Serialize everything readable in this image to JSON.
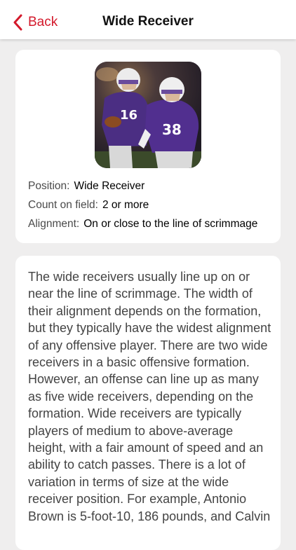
{
  "nav": {
    "back_label": "Back",
    "title": "Wide Receiver"
  },
  "colors": {
    "accent": "#d3192b",
    "page_background": "#efeeee",
    "card_background": "#ffffff"
  },
  "icons": {
    "back": "chevron-left-icon"
  },
  "player_image": {
    "jersey_numbers": [
      "16",
      "38"
    ]
  },
  "info": {
    "position_label": "Position:",
    "position_value": "Wide Receiver",
    "count_label": "Count on field:",
    "count_value": "2 or more",
    "alignment_label": "Alignment:",
    "alignment_value": "On or close to the line of scrimmage"
  },
  "description": "The wide receivers usually line up on or near the line of scrimmage. The width of their alignment depends on the formation, but they typically have the widest alignment of any offensive player. There are two wide receivers in a basic offensive formation. However, an offense can line up as many as five wide receivers, depending on the formation. Wide receivers are typically players of medium to above-average height, with a fair amount of speed and an ability to catch passes. There is a lot of variation in terms of size at the wide receiver position. For example, Antonio Brown is 5-foot-10, 186 pounds, and Calvin"
}
